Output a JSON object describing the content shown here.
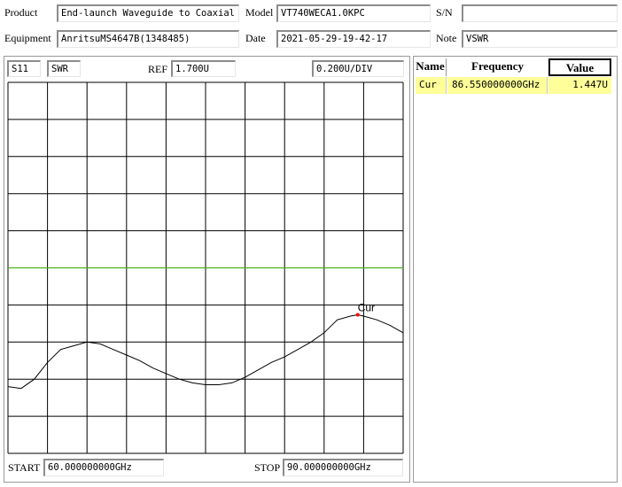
{
  "header": {
    "product_label": "Product",
    "product_value": "End-launch Waveguide to Coaxial",
    "model_label": "Model",
    "model_value": "VT740WECA1.0KPC",
    "sn_label": "S/N",
    "sn_value": "",
    "equipment_label": "Equipment",
    "equipment_value": "AnritsuMS4647B(1348485)",
    "date_label": "Date",
    "date_value": "2021-05-29-19-42-17",
    "note_label": "Note",
    "note_value": "VSWR"
  },
  "plot": {
    "param": "S11",
    "format": "SWR",
    "ref_label": "REF",
    "ref_value": "1.700U",
    "scale_value": "0.200U/DIV",
    "start_label": "START",
    "start_value": "60.000000000GHz",
    "stop_label": "STOP",
    "stop_value": "90.000000000GHz",
    "marker_label": "Cur"
  },
  "markers_table": {
    "headers": [
      "Name",
      "Frequency",
      "Value"
    ],
    "rows": [
      {
        "name": "Cur",
        "frequency": "86.550000000GHz",
        "value": "1.447U"
      }
    ]
  },
  "colors": {
    "grid": "#000000",
    "reference_line": "#4caf1e",
    "trace": "#000000",
    "marker": "#ff0000",
    "row_highlight": "#ffff99"
  },
  "chart_data": {
    "type": "line",
    "xlabel": "",
    "ylabel": "",
    "xlim": [
      60,
      90
    ],
    "ylim": [
      0.7,
      2.7
    ],
    "reference_value": 1.7,
    "marker": {
      "name": "Cur",
      "x": 86.55,
      "y": 1.447
    },
    "series": [
      {
        "x": [
          60,
          61,
          62,
          63,
          64,
          65,
          66,
          67,
          68,
          69,
          70,
          71,
          72,
          73,
          74,
          75,
          76,
          77,
          78,
          79,
          80,
          81,
          82,
          83,
          84,
          85,
          86,
          86.55,
          87,
          88,
          89,
          90
        ],
        "values": [
          1.06,
          1.05,
          1.1,
          1.19,
          1.26,
          1.28,
          1.3,
          1.29,
          1.26,
          1.23,
          1.2,
          1.16,
          1.13,
          1.1,
          1.08,
          1.07,
          1.07,
          1.08,
          1.11,
          1.15,
          1.19,
          1.22,
          1.26,
          1.3,
          1.35,
          1.42,
          1.44,
          1.447,
          1.44,
          1.42,
          1.39,
          1.35
        ]
      }
    ]
  }
}
